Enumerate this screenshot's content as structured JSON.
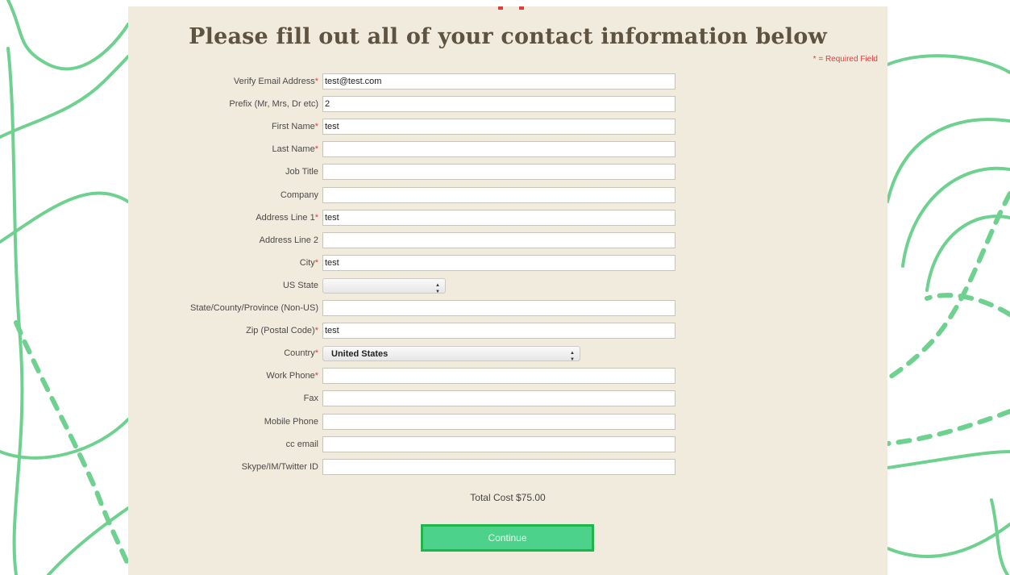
{
  "page": {
    "title": "Please fill out all of your contact information below",
    "required_note": "* = Required Field",
    "total_cost": "Total Cost $75.00",
    "continue_label": "Continue"
  },
  "fields": [
    {
      "label": "Verify Email Address",
      "required": true,
      "value": "test@test.com"
    },
    {
      "label": "Prefix (Mr, Mrs, Dr etc)",
      "required": false,
      "value": "2"
    },
    {
      "label": "First Name",
      "required": true,
      "value": "test"
    },
    {
      "label": "Last Name",
      "required": true,
      "value": ""
    },
    {
      "label": "Job Title",
      "required": false,
      "value": ""
    },
    {
      "label": "Company",
      "required": false,
      "value": ""
    },
    {
      "label": "Address Line 1",
      "required": true,
      "value": "test"
    },
    {
      "label": "Address Line 2",
      "required": false,
      "value": ""
    },
    {
      "label": "City",
      "required": true,
      "value": "test"
    },
    {
      "label": "US State",
      "required": false,
      "value": ""
    },
    {
      "label": "State/County/Province (Non-US)",
      "required": false,
      "value": ""
    },
    {
      "label": "Zip (Postal Code)",
      "required": true,
      "value": "test"
    },
    {
      "label": "Country",
      "required": true,
      "value": "United States"
    },
    {
      "label": "Work Phone",
      "required": true,
      "value": ""
    },
    {
      "label": "Fax",
      "required": false,
      "value": ""
    },
    {
      "label": "Mobile Phone",
      "required": false,
      "value": ""
    },
    {
      "label": "cc email",
      "required": false,
      "value": ""
    },
    {
      "label": "Skype/IM/Twitter ID",
      "required": false,
      "value": ""
    }
  ],
  "colors": {
    "accent_green": "#4cd28a",
    "required_red": "#e23b3b",
    "panel_bg": "#f1ebdd"
  }
}
